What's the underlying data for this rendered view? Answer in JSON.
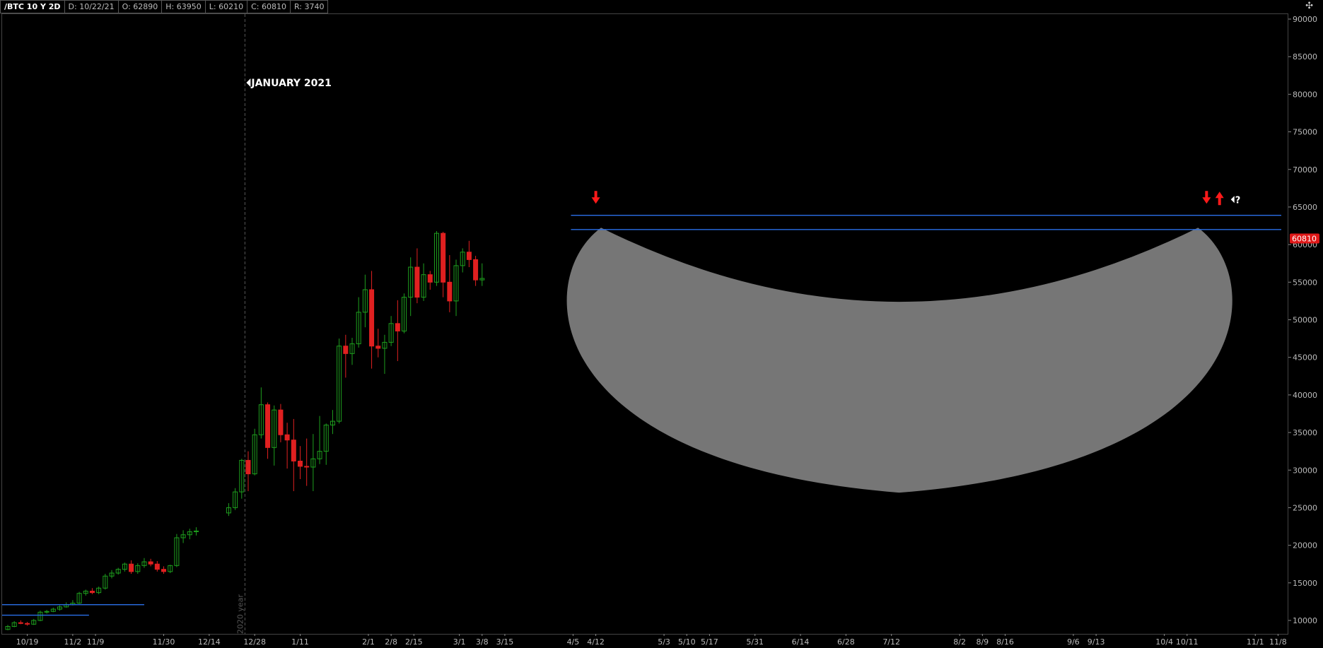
{
  "header": {
    "symbol": "/BTC 10 Y 2D",
    "date": "D: 10/22/21",
    "open": "O: 62890",
    "high": "H: 63950",
    "low": "L: 60210",
    "close": "C: 60810",
    "range": "R: 3740"
  },
  "annotations": {
    "period_label": "JANUARY 2021",
    "year_label": "2020 year",
    "question": "?"
  },
  "colors": {
    "up": "#1e9e1e",
    "down": "#e02020",
    "level": "#2a6fe8",
    "bowl": "#7c7c7c",
    "arrow": "#ff1a1a",
    "price_tag": "#e01818"
  },
  "chart_data": {
    "type": "candlestick",
    "ylim": [
      7000,
      92000
    ],
    "y_ticks": [
      10000,
      15000,
      20000,
      25000,
      30000,
      35000,
      40000,
      45000,
      50000,
      55000,
      60000,
      65000,
      70000,
      75000,
      80000,
      85000,
      90000
    ],
    "x_range": [
      "2020-10-13",
      "2021-11-09"
    ],
    "x_ticks": [
      {
        "date": "2020-10-19",
        "label": "10/19"
      },
      {
        "date": "2020-11-02",
        "label": "11/2"
      },
      {
        "date": "2020-11-09",
        "label": "11/9"
      },
      {
        "date": "2020-11-30",
        "label": "11/30"
      },
      {
        "date": "2020-12-14",
        "label": "12/14"
      },
      {
        "date": "2020-12-28",
        "label": "12/28"
      },
      {
        "date": "2021-01-11",
        "label": "1/11"
      },
      {
        "date": "2021-02-01",
        "label": "2/1"
      },
      {
        "date": "2021-02-08",
        "label": "2/8"
      },
      {
        "date": "2021-02-15",
        "label": "2/15"
      },
      {
        "date": "2021-03-01",
        "label": "3/1"
      },
      {
        "date": "2021-03-08",
        "label": "3/8"
      },
      {
        "date": "2021-03-15",
        "label": "3/15"
      },
      {
        "date": "2021-04-05",
        "label": "4/5"
      },
      {
        "date": "2021-04-12",
        "label": "4/12"
      },
      {
        "date": "2021-05-03",
        "label": "5/3"
      },
      {
        "date": "2021-05-10",
        "label": "5/10"
      },
      {
        "date": "2021-05-17",
        "label": "5/17"
      },
      {
        "date": "2021-05-31",
        "label": "5/31"
      },
      {
        "date": "2021-06-14",
        "label": "6/14"
      },
      {
        "date": "2021-06-28",
        "label": "6/28"
      },
      {
        "date": "2021-07-12",
        "label": "7/12"
      },
      {
        "date": "2021-08-02",
        "label": "8/2"
      },
      {
        "date": "2021-08-09",
        "label": "8/9"
      },
      {
        "date": "2021-08-16",
        "label": "8/16"
      },
      {
        "date": "2021-09-06",
        "label": "9/6"
      },
      {
        "date": "2021-09-13",
        "label": "9/13"
      },
      {
        "date": "2021-10-04",
        "label": "10/4"
      },
      {
        "date": "2021-10-11",
        "label": "10/11"
      },
      {
        "date": "2021-11-01",
        "label": "11/1"
      },
      {
        "date": "2021-11-08",
        "label": "11/8"
      }
    ],
    "last_price": 60810,
    "resistance_levels": [
      {
        "price": 63900,
        "from": "2021-04-05",
        "to": "2021-11-09"
      },
      {
        "price": 62000,
        "from": "2021-04-05",
        "to": "2021-11-09"
      }
    ],
    "support_levels": [
      {
        "price": 12100,
        "from": "2020-10-13",
        "to": "2020-11-24"
      },
      {
        "price": 10700,
        "from": "2020-10-13",
        "to": "2020-11-07"
      }
    ],
    "year_marker_date": "2020-12-25",
    "bowl": {
      "from": "2021-04-01",
      "to": "2021-10-27",
      "top": 63000,
      "inner_bottom": 52500,
      "outer_bottom": 27000
    },
    "arrows": [
      {
        "date": "2021-04-12",
        "price": 66000,
        "dir": "down"
      },
      {
        "date": "2021-10-17",
        "price": 66000,
        "dir": "down"
      },
      {
        "date": "2021-10-21",
        "price": 66000,
        "dir": "up"
      }
    ],
    "candles": [
      {
        "d": "2020-10-13",
        "o": 8800,
        "h": 9400,
        "l": 8700,
        "c": 9200
      },
      {
        "d": "2020-10-15",
        "o": 9200,
        "h": 9900,
        "l": 9100,
        "c": 9700
      },
      {
        "d": "2020-10-17",
        "o": 9700,
        "h": 10000,
        "l": 9500,
        "c": 9600
      },
      {
        "d": "2020-10-19",
        "o": 9600,
        "h": 9800,
        "l": 9300,
        "c": 9500
      },
      {
        "d": "2020-10-21",
        "o": 9500,
        "h": 10200,
        "l": 9400,
        "c": 10000
      },
      {
        "d": "2020-10-23",
        "o": 10000,
        "h": 11300,
        "l": 9900,
        "c": 11100
      },
      {
        "d": "2020-10-25",
        "o": 11100,
        "h": 11400,
        "l": 10900,
        "c": 11200
      },
      {
        "d": "2020-10-27",
        "o": 11200,
        "h": 11700,
        "l": 11100,
        "c": 11500
      },
      {
        "d": "2020-10-29",
        "o": 11500,
        "h": 12000,
        "l": 11300,
        "c": 11800
      },
      {
        "d": "2020-10-31",
        "o": 11800,
        "h": 12400,
        "l": 11700,
        "c": 12100
      },
      {
        "d": "2020-11-02",
        "o": 12100,
        "h": 12700,
        "l": 12000,
        "c": 12300
      },
      {
        "d": "2020-11-04",
        "o": 12300,
        "h": 13800,
        "l": 12200,
        "c": 13600
      },
      {
        "d": "2020-11-06",
        "o": 13600,
        "h": 14100,
        "l": 13300,
        "c": 13900
      },
      {
        "d": "2020-11-08",
        "o": 13900,
        "h": 14300,
        "l": 13500,
        "c": 13700
      },
      {
        "d": "2020-11-10",
        "o": 13700,
        "h": 14500,
        "l": 13500,
        "c": 14300
      },
      {
        "d": "2020-11-12",
        "o": 14300,
        "h": 16200,
        "l": 14100,
        "c": 15900
      },
      {
        "d": "2020-11-14",
        "o": 15900,
        "h": 16700,
        "l": 15600,
        "c": 16300
      },
      {
        "d": "2020-11-16",
        "o": 16300,
        "h": 17000,
        "l": 16100,
        "c": 16800
      },
      {
        "d": "2020-11-18",
        "o": 16800,
        "h": 17700,
        "l": 16500,
        "c": 17500
      },
      {
        "d": "2020-11-20",
        "o": 17500,
        "h": 18000,
        "l": 16200,
        "c": 16500
      },
      {
        "d": "2020-11-22",
        "o": 16500,
        "h": 17600,
        "l": 16200,
        "c": 17300
      },
      {
        "d": "2020-11-24",
        "o": 17300,
        "h": 18300,
        "l": 17000,
        "c": 17800
      },
      {
        "d": "2020-11-26",
        "o": 17800,
        "h": 18200,
        "l": 17200,
        "c": 17500
      },
      {
        "d": "2020-11-28",
        "o": 17500,
        "h": 17900,
        "l": 16500,
        "c": 16800
      },
      {
        "d": "2020-11-30",
        "o": 16800,
        "h": 17200,
        "l": 16200,
        "c": 16500
      },
      {
        "d": "2020-12-02",
        "o": 16500,
        "h": 17400,
        "l": 16300,
        "c": 17300
      },
      {
        "d": "2020-12-04",
        "o": 17300,
        "h": 21500,
        "l": 17100,
        "c": 21000
      },
      {
        "d": "2020-12-06",
        "o": 21000,
        "h": 22000,
        "l": 20300,
        "c": 21400
      },
      {
        "d": "2020-12-08",
        "o": 21400,
        "h": 22200,
        "l": 20800,
        "c": 21800
      },
      {
        "d": "2020-12-10",
        "o": 21800,
        "h": 22400,
        "l": 21300,
        "c": 21900
      },
      {
        "d": "2020-12-20",
        "o": 24300,
        "h": 25600,
        "l": 23900,
        "c": 25000
      },
      {
        "d": "2020-12-22",
        "o": 25000,
        "h": 27600,
        "l": 24700,
        "c": 27100
      },
      {
        "d": "2020-12-24",
        "o": 27100,
        "h": 31500,
        "l": 26200,
        "c": 31300
      },
      {
        "d": "2020-12-26",
        "o": 31300,
        "h": 32500,
        "l": 27200,
        "c": 29500
      },
      {
        "d": "2020-12-28",
        "o": 29500,
        "h": 35500,
        "l": 29300,
        "c": 34700
      },
      {
        "d": "2020-12-30",
        "o": 34700,
        "h": 41000,
        "l": 34200,
        "c": 38700
      },
      {
        "d": "2021-01-01",
        "o": 38700,
        "h": 39000,
        "l": 31500,
        "c": 33000
      },
      {
        "d": "2021-01-03",
        "o": 33000,
        "h": 38600,
        "l": 30600,
        "c": 38000
      },
      {
        "d": "2021-01-05",
        "o": 38000,
        "h": 38800,
        "l": 33700,
        "c": 34700
      },
      {
        "d": "2021-01-07",
        "o": 34700,
        "h": 36300,
        "l": 30200,
        "c": 34000
      },
      {
        "d": "2021-01-09",
        "o": 34000,
        "h": 36800,
        "l": 27200,
        "c": 31200
      },
      {
        "d": "2021-01-11",
        "o": 31200,
        "h": 33200,
        "l": 28800,
        "c": 30500
      },
      {
        "d": "2021-01-13",
        "o": 30500,
        "h": 34200,
        "l": 27900,
        "c": 30400
      },
      {
        "d": "2021-01-15",
        "o": 30400,
        "h": 34800,
        "l": 27200,
        "c": 31500
      },
      {
        "d": "2021-01-17",
        "o": 31500,
        "h": 37200,
        "l": 30800,
        "c": 32500
      },
      {
        "d": "2021-01-19",
        "o": 32500,
        "h": 36200,
        "l": 30700,
        "c": 36000
      },
      {
        "d": "2021-01-21",
        "o": 36000,
        "h": 38000,
        "l": 34800,
        "c": 36500
      },
      {
        "d": "2021-01-23",
        "o": 36500,
        "h": 47500,
        "l": 36200,
        "c": 46500
      },
      {
        "d": "2021-01-25",
        "o": 46500,
        "h": 48000,
        "l": 42300,
        "c": 45500
      },
      {
        "d": "2021-01-27",
        "o": 45500,
        "h": 47600,
        "l": 44000,
        "c": 46800
      },
      {
        "d": "2021-01-29",
        "o": 46800,
        "h": 53000,
        "l": 46300,
        "c": 51000
      },
      {
        "d": "2021-01-31",
        "o": 51000,
        "h": 56000,
        "l": 49000,
        "c": 54000
      },
      {
        "d": "2021-02-02",
        "o": 54000,
        "h": 56500,
        "l": 43500,
        "c": 46500
      },
      {
        "d": "2021-02-04",
        "o": 46500,
        "h": 48800,
        "l": 45000,
        "c": 46200
      },
      {
        "d": "2021-02-06",
        "o": 46200,
        "h": 48000,
        "l": 42800,
        "c": 47000
      },
      {
        "d": "2021-02-08",
        "o": 47000,
        "h": 50500,
        "l": 46500,
        "c": 49500
      },
      {
        "d": "2021-02-10",
        "o": 49500,
        "h": 52600,
        "l": 44500,
        "c": 48500
      },
      {
        "d": "2021-02-12",
        "o": 48500,
        "h": 53500,
        "l": 48200,
        "c": 53000
      },
      {
        "d": "2021-02-14",
        "o": 53000,
        "h": 58300,
        "l": 50500,
        "c": 57000
      },
      {
        "d": "2021-02-16",
        "o": 57000,
        "h": 59500,
        "l": 52200,
        "c": 53000
      },
      {
        "d": "2021-02-18",
        "o": 53000,
        "h": 57500,
        "l": 52500,
        "c": 56000
      },
      {
        "d": "2021-02-20",
        "o": 56000,
        "h": 56500,
        "l": 54000,
        "c": 55000
      },
      {
        "d": "2021-02-22",
        "o": 55000,
        "h": 61800,
        "l": 54500,
        "c": 61500
      },
      {
        "d": "2021-02-24",
        "o": 61500,
        "h": 61700,
        "l": 53000,
        "c": 55000
      },
      {
        "d": "2021-02-26",
        "o": 55000,
        "h": 58600,
        "l": 51000,
        "c": 52500
      },
      {
        "d": "2021-02-28",
        "o": 52500,
        "h": 58000,
        "l": 50500,
        "c": 57200
      },
      {
        "d": "2021-03-02",
        "o": 57200,
        "h": 59500,
        "l": 56300,
        "c": 59000
      },
      {
        "d": "2021-03-04",
        "o": 59000,
        "h": 60500,
        "l": 57000,
        "c": 58000
      },
      {
        "d": "2021-03-06",
        "o": 58000,
        "h": 58500,
        "l": 54500,
        "c": 55300
      },
      {
        "d": "2021-03-08",
        "o": 55300,
        "h": 57500,
        "l": 54500,
        "c": 55500
      }
    ]
  }
}
